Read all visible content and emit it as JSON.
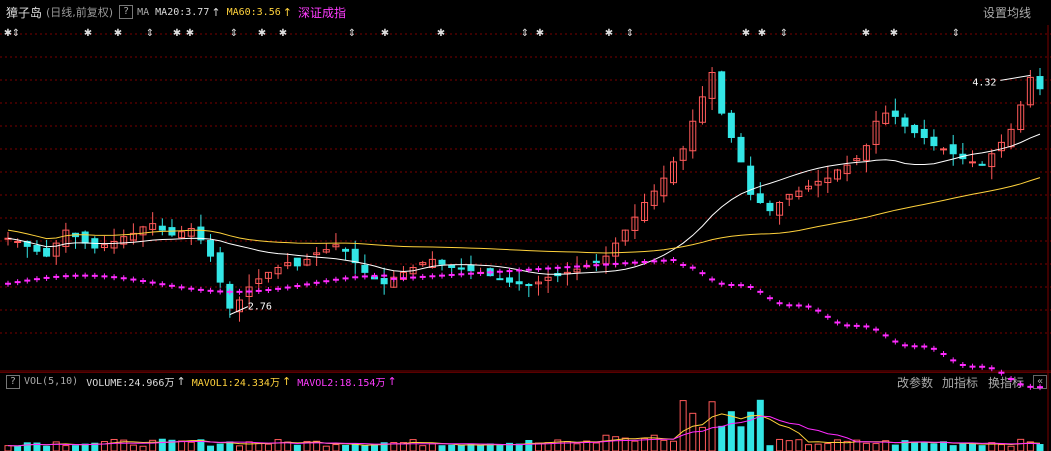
{
  "header": {
    "stock_name": "獐子岛",
    "period": "(日线,前复权)",
    "help": "?",
    "ma_label": "MA",
    "ma20": "MA20:3.77",
    "ma60": "MA60:3.56",
    "overlay": "深证成指",
    "settings": "设置均线"
  },
  "volume_header": {
    "help": "?",
    "title": "VOL(5,10)",
    "volume": "VOLUME:24.966万",
    "mavol1": "MAVOL1:24.334万",
    "mavol2": "MAVOL2:18.154万",
    "change_params": "改参数",
    "add_indicator": "加指标",
    "swap_indicator": "换指标",
    "minimize": "«"
  },
  "annotations": {
    "high": "4.32",
    "low": "2.76"
  },
  "arrow_glyph": "↑",
  "colors": {
    "up": "#ff5a5a",
    "down": "#33e6e6",
    "ma20": "#ffffff",
    "ma60": "#ffd23c",
    "index": "#ff2bff",
    "grid": "#7a0000"
  },
  "chart_data": {
    "type": "candlestick",
    "price_range": [
      2.55,
      4.55
    ],
    "visible_labels": [
      "4.32",
      "2.76"
    ],
    "close_series_sample": [
      3.33,
      3.31,
      3.28,
      3.25,
      3.22,
      3.3,
      3.38,
      3.34,
      3.3,
      3.27,
      3.29,
      3.31,
      3.34,
      3.36,
      3.4,
      3.42,
      3.38,
      3.35,
      3.37,
      3.39,
      3.32,
      3.22,
      3.06,
      2.9,
      2.95,
      3.03,
      3.08,
      3.12,
      3.15,
      3.18,
      3.16,
      3.2,
      3.24,
      3.26,
      3.29,
      3.25,
      3.18,
      3.12,
      3.08,
      3.05,
      3.09,
      3.12,
      3.15,
      3.18,
      3.2,
      3.17,
      3.15,
      3.14,
      3.13,
      3.12,
      3.1,
      3.08,
      3.06,
      3.05,
      3.04,
      3.06,
      3.09,
      3.1,
      3.12,
      3.14,
      3.16,
      3.18,
      3.22,
      3.3,
      3.38,
      3.46,
      3.55,
      3.62,
      3.7,
      3.8,
      3.88,
      4.05,
      4.2,
      4.35,
      4.1,
      3.95,
      3.8,
      3.6,
      3.55,
      3.5,
      3.55,
      3.6,
      3.62,
      3.65,
      3.68,
      3.7,
      3.75,
      3.78,
      3.82,
      3.9,
      4.05,
      4.1,
      4.08,
      4.02,
      3.98,
      3.95,
      3.9,
      3.88,
      3.85,
      3.82,
      3.8,
      3.78,
      3.85,
      3.92,
      4.0,
      4.15,
      4.32,
      4.25
    ]
  }
}
